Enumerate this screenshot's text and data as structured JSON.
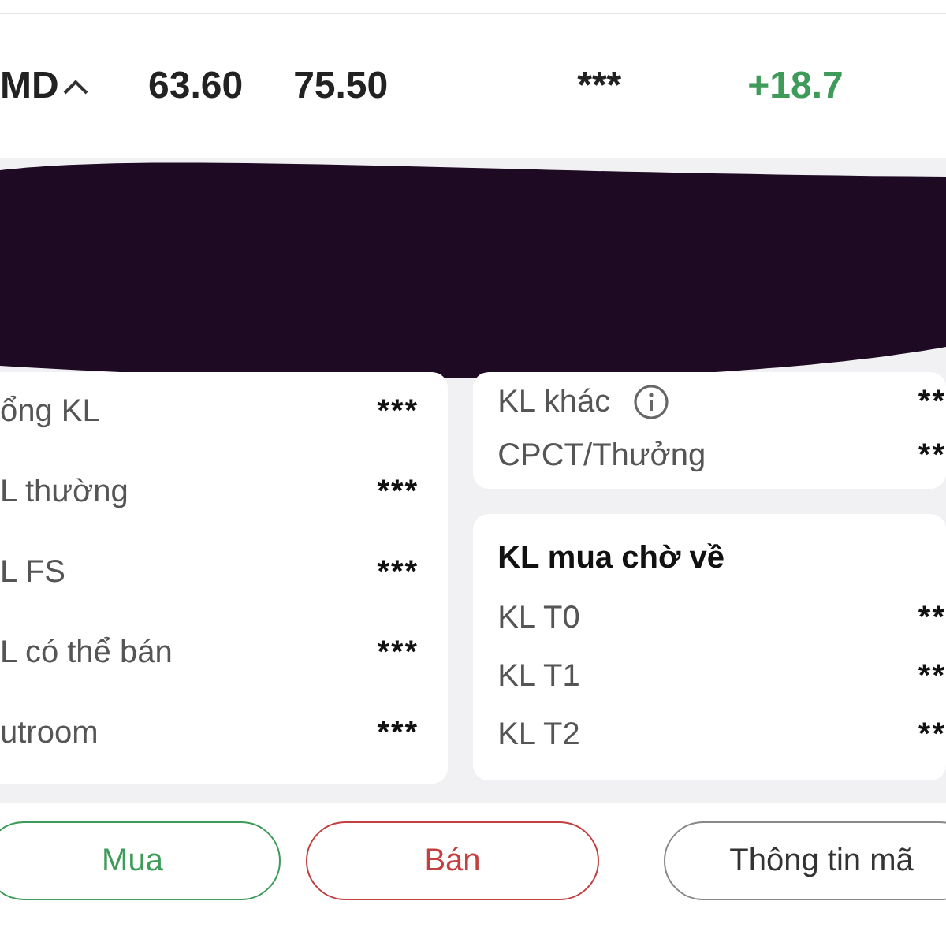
{
  "header": {
    "symbol": "MD",
    "price_1": "63.60",
    "price_2": "75.50",
    "hidden_value": "***",
    "change": "+18.7"
  },
  "holdings": [
    {
      "label": "ổng KL",
      "value": "***"
    },
    {
      "label": "L thường",
      "value": "***"
    },
    {
      "label": "L FS",
      "value": "***"
    },
    {
      "label": "L có thể bán",
      "value": "***"
    },
    {
      "label": "utroom",
      "value": "***"
    }
  ],
  "other": [
    {
      "label": "KL khác",
      "info": true,
      "value": "**"
    },
    {
      "label": "CPCT/Thưởng",
      "info": false,
      "value": "**"
    }
  ],
  "pending": {
    "title": "KL mua chờ về",
    "rows": [
      {
        "label": "KL T0",
        "value": "**"
      },
      {
        "label": "KL T1",
        "value": "**"
      },
      {
        "label": "KL T2",
        "value": "**"
      }
    ]
  },
  "actions": [
    {
      "label": "Mua",
      "kind": "buy"
    },
    {
      "label": "Bán",
      "kind": "sell"
    },
    {
      "label": "Thông tin mã",
      "kind": "info"
    }
  ]
}
